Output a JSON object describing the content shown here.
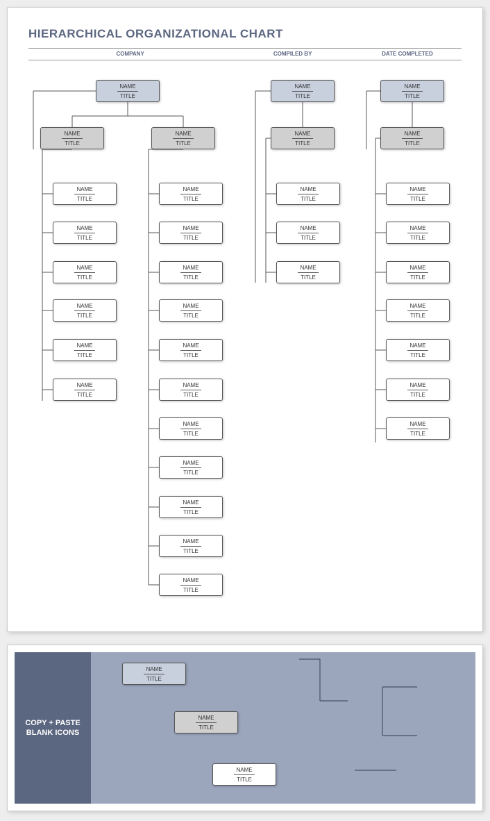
{
  "title": "HIERARCHICAL ORGANIZATIONAL CHART",
  "headers": {
    "company": "COMPANY",
    "compiled_by": "COMPILED BY",
    "date_completed": "DATE COMPLETED"
  },
  "nodeText": {
    "name": "NAME",
    "title": "TITLE"
  },
  "panel2": {
    "label": "COPY + PASTE\nBLANK ICONS"
  }
}
